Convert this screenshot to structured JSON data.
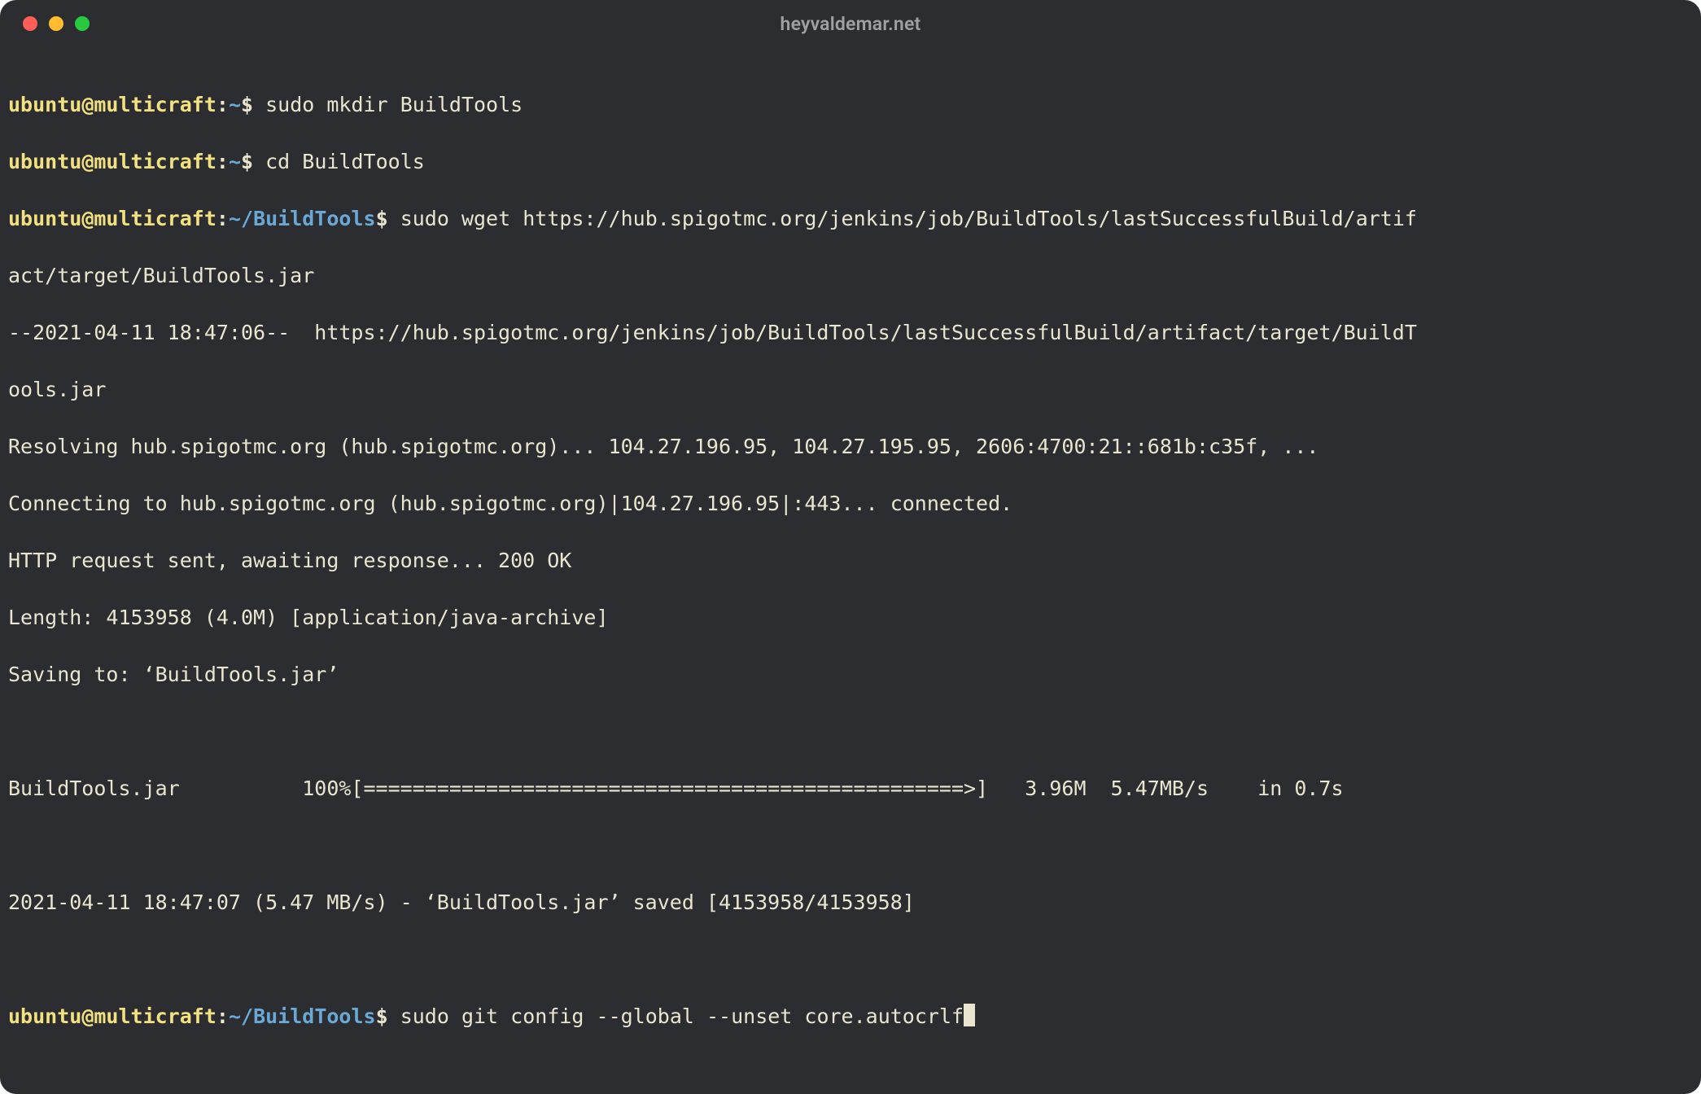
{
  "titlebar": {
    "title": "heyvaldemar.net"
  },
  "colors": {
    "bg": "#2b2d31",
    "text": "#e9e5cf",
    "prompt_user": "#f3e180",
    "prompt_path": "#6aa8d6",
    "traffic_red": "#ff5f57",
    "traffic_yellow": "#febc2e",
    "traffic_green": "#28c840"
  },
  "prompts": {
    "p1": {
      "user": "ubuntu",
      "at": "@",
      "host": "multicraft",
      "colon": ":",
      "path_prefix": "~",
      "path": "",
      "dollar": "$ "
    },
    "p2": {
      "user": "ubuntu",
      "at": "@",
      "host": "multicraft",
      "colon": ":",
      "path_prefix": "~",
      "path": "",
      "dollar": "$ "
    },
    "p3": {
      "user": "ubuntu",
      "at": "@",
      "host": "multicraft",
      "colon": ":",
      "path_prefix": "~",
      "path": "/BuildTools",
      "dollar": "$ "
    },
    "p4": {
      "user": "ubuntu",
      "at": "@",
      "host": "multicraft",
      "colon": ":",
      "path_prefix": "~",
      "path": "/BuildTools",
      "dollar": "$ "
    }
  },
  "commands": {
    "c1": "sudo mkdir BuildTools",
    "c2": "cd BuildTools",
    "c3a": "sudo wget https://hub.spigotmc.org/jenkins/job/BuildTools/lastSuccessfulBuild/artif",
    "c3b": "act/target/BuildTools.jar",
    "c4": "sudo git config --global --unset core.autocrlf"
  },
  "output": {
    "l1": "--2021-04-11 18:47:06--  https://hub.spigotmc.org/jenkins/job/BuildTools/lastSuccessfulBuild/artifact/target/BuildT",
    "l2": "ools.jar",
    "l3": "Resolving hub.spigotmc.org (hub.spigotmc.org)... 104.27.196.95, 104.27.195.95, 2606:4700:21::681b:c35f, ...",
    "l4": "Connecting to hub.spigotmc.org (hub.spigotmc.org)|104.27.196.95|:443... connected.",
    "l5": "HTTP request sent, awaiting response... 200 OK",
    "l6": "Length: 4153958 (4.0M) [application/java-archive]",
    "l7": "Saving to: ‘BuildTools.jar’",
    "blank1": " ",
    "l8": "BuildTools.jar          100%[=================================================>]   3.96M  5.47MB/s    in 0.7s",
    "blank2": " ",
    "l9": "2021-04-11 18:47:07 (5.47 MB/s) - ‘BuildTools.jar’ saved [4153958/4153958]",
    "blank3": " "
  }
}
